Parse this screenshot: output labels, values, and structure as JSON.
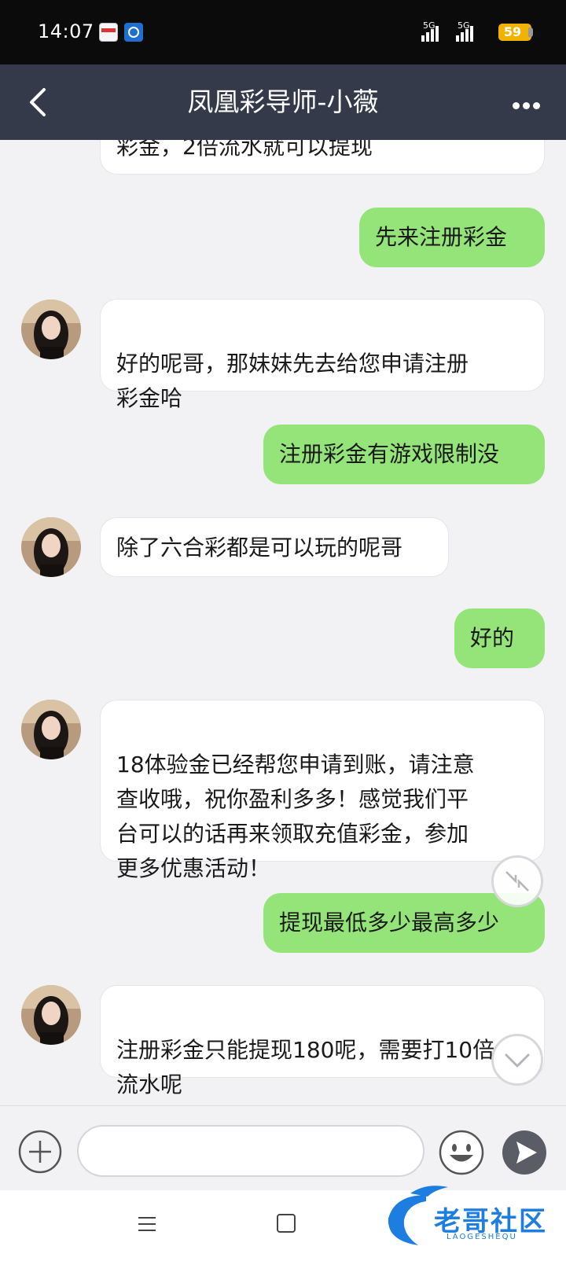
{
  "status_bar": {
    "time": "14:07",
    "signal1": "5G",
    "signal2": "5G",
    "battery": "59"
  },
  "nav": {
    "title": "凤凰彩导师-小薇"
  },
  "messages": [
    {
      "side": "in",
      "text": "彩金，2倍流水就可以提现"
    },
    {
      "side": "out",
      "text": "先来注册彩金"
    },
    {
      "side": "in",
      "text": "好的呢哥，那妹妹先去给您申请注册\n彩金哈"
    },
    {
      "side": "out",
      "text": "注册彩金有游戏限制没"
    },
    {
      "side": "in",
      "text": "除了六合彩都是可以玩的呢哥"
    },
    {
      "side": "out",
      "text": "好的"
    },
    {
      "side": "in",
      "text": "18体验金已经帮您申请到账，请注意\n查收哦，祝你盈利多多！感觉我们平\n台可以的话再来领取充值彩金，参加\n更多优惠活动！"
    },
    {
      "side": "out",
      "text": "提现最低多少最高多少"
    },
    {
      "side": "in",
      "text": "注册彩金只能提现180呢，需要打10倍\n流水呢"
    }
  ],
  "input": {
    "placeholder": ""
  },
  "watermark": {
    "text": "老哥社区",
    "sub": "LAOGESHEQU"
  },
  "colors": {
    "nav_bg": "#353a4a",
    "outgoing_bubble": "#95e47a",
    "incoming_bubble": "#ffffff",
    "background": "#f2f2f4"
  }
}
